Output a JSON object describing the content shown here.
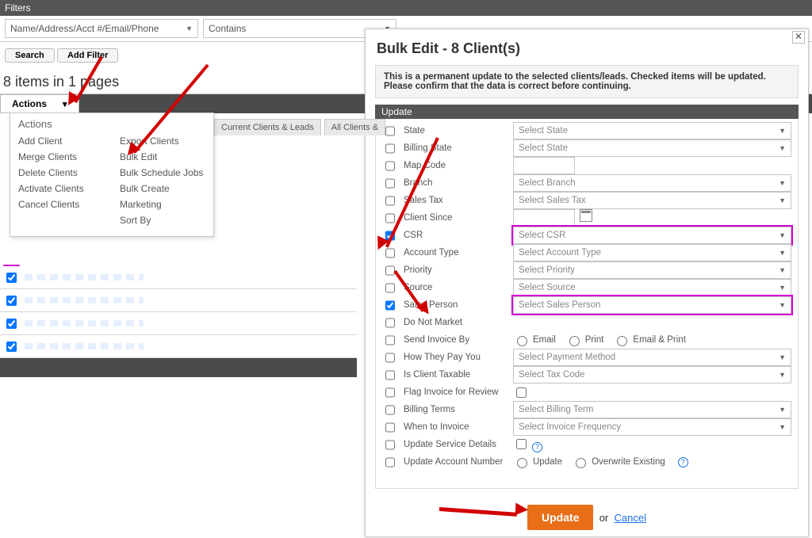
{
  "filters": {
    "title": "Filters",
    "field_combo": "Name/Address/Acct #/Email/Phone",
    "op_combo": "Contains",
    "search_btn": "Search",
    "add_filter_btn": "Add Filter"
  },
  "summary": "8 items in 1 pages",
  "actions": {
    "button": "Actions",
    "header": "Actions",
    "col1": [
      "Add Client",
      "Merge Clients",
      "Delete Clients",
      "Activate Clients",
      "Cancel Clients"
    ],
    "col2": [
      "Export Clients",
      "Bulk Edit",
      "Bulk Schedule Jobs",
      "Bulk Create",
      "Marketing",
      "Sort By"
    ]
  },
  "tabs": {
    "t1": "Current Clients & Leads",
    "t2": "All Clients &"
  },
  "modal": {
    "title": "Bulk Edit - 8 Client(s)",
    "warning1": "This is a permanent update to the selected clients/leads. Checked items will be updated.",
    "warning2": "Please confirm that the data is correct before continuing.",
    "update_header": "Update",
    "rows": {
      "state": {
        "label": "State",
        "dd": "Select State"
      },
      "billing_state": {
        "label": "Billing State",
        "dd": "Select State"
      },
      "map_code": {
        "label": "Map Code"
      },
      "branch": {
        "label": "Branch",
        "dd": "Select Branch"
      },
      "sales_tax": {
        "label": "Sales Tax",
        "dd": "Select Sales Tax"
      },
      "client_since": {
        "label": "Client Since"
      },
      "csr": {
        "label": "CSR",
        "dd": "Select CSR"
      },
      "account_type": {
        "label": "Account Type",
        "dd": "Select Account Type"
      },
      "priority": {
        "label": "Priority",
        "dd": "Select Priority"
      },
      "source": {
        "label": "Source",
        "dd": "Select Source"
      },
      "sales_person": {
        "label": "Sales Person",
        "dd": "Select Sales Person"
      },
      "do_not_market": {
        "label": "Do Not Market"
      },
      "send_invoice_by": {
        "label": "Send Invoice By",
        "opts": [
          "Email",
          "Print",
          "Email & Print"
        ]
      },
      "how_they_pay": {
        "label": "How They Pay You",
        "dd": "Select Payment Method"
      },
      "is_client_taxable": {
        "label": "Is Client Taxable",
        "dd": "Select Tax Code"
      },
      "flag_invoice": {
        "label": "Flag Invoice for Review"
      },
      "billing_terms": {
        "label": "Billing Terms",
        "dd": "Select Billing Term"
      },
      "when_to_invoice": {
        "label": "When to Invoice",
        "dd": "Select Invoice Frequency"
      },
      "update_svc": {
        "label": "Update Service Details"
      },
      "update_acct": {
        "label": "Update Account Number",
        "opts": [
          "Update",
          "Overwrite Existing"
        ]
      }
    },
    "footer": {
      "update": "Update",
      "or": "or",
      "cancel": "Cancel"
    }
  }
}
